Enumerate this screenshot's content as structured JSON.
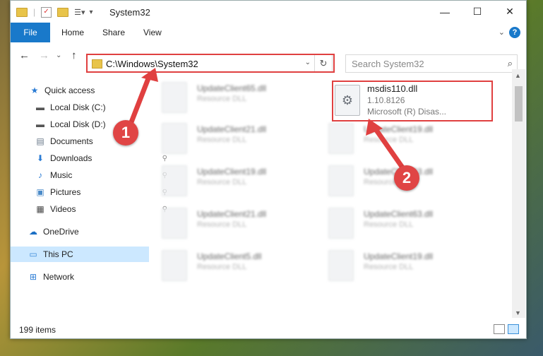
{
  "window": {
    "title": "System32",
    "controls": {
      "minimize": "—",
      "maximize": "☐",
      "close": "✕"
    }
  },
  "ribbon": {
    "tabs": [
      "File",
      "Home",
      "Share",
      "View"
    ],
    "expand": "⌄",
    "help": "?"
  },
  "nav": {
    "back": "←",
    "forward": "→",
    "recent": "⌄",
    "up": "↑",
    "address": "C:\\Windows\\System32",
    "address_dropdown": "⌄",
    "refresh": "↻",
    "search_placeholder": "Search System32",
    "search_icon": "⌕"
  },
  "sidebar": {
    "items": [
      {
        "label": "Quick access",
        "icon": "star-icon",
        "glyph": "★",
        "color": "#2a7bd4"
      },
      {
        "label": "Local Disk (C:)",
        "icon": "drive-icon",
        "glyph": "▬",
        "color": "#555555"
      },
      {
        "label": "Local Disk (D:)",
        "icon": "drive-icon",
        "glyph": "▬",
        "color": "#555555"
      },
      {
        "label": "Documents",
        "icon": "documents-icon",
        "glyph": "▤",
        "color": "#6a7a8a"
      },
      {
        "label": "Downloads",
        "icon": "download-icon",
        "glyph": "⬇",
        "color": "#2a7bd4"
      },
      {
        "label": "Music",
        "icon": "music-icon",
        "glyph": "♪",
        "color": "#2a7bd4"
      },
      {
        "label": "Pictures",
        "icon": "pictures-icon",
        "glyph": "▣",
        "color": "#4a8ac8"
      },
      {
        "label": "Videos",
        "icon": "videos-icon",
        "glyph": "▦",
        "color": "#444444"
      },
      {
        "label": "OneDrive",
        "icon": "cloud-icon",
        "glyph": "☁",
        "color": "#1a6fc4"
      },
      {
        "label": "This PC",
        "icon": "computer-icon",
        "glyph": "▭",
        "color": "#3a8ad8"
      },
      {
        "label": "Network",
        "icon": "network-icon",
        "glyph": "⊞",
        "color": "#2a7bd4"
      }
    ],
    "pin_glyph": "⚲"
  },
  "files_blurred": [
    {
      "name": "UpdateClient65.dll",
      "type": "Resource DLL"
    },
    {
      "name": "UpdateClient21.dll",
      "type": "Resource DLL"
    },
    {
      "name": "UpdateClient19.dll",
      "type": "Resource DLL"
    },
    {
      "name": "UpdateClient21.dll",
      "type": "Resource DLL"
    },
    {
      "name": "UpdateClient5.dll",
      "type": "Resource DLL"
    },
    {
      "name": "UpdateClient19.dll",
      "type": "Resource DLL"
    },
    {
      "name": "UpdateClient63.dll",
      "type": "Resource DLL"
    },
    {
      "name": "UpdateClient63.dll",
      "type": "Resource DLL"
    },
    {
      "name": "UpdateClient19.dll",
      "type": "Resource DLL"
    }
  ],
  "highlighted_file": {
    "name": "msdis110.dll",
    "version": "1.10.8126",
    "description": "Microsoft (R) Disas...",
    "icon_glyph": "⚙"
  },
  "status": {
    "items": "199 items"
  },
  "annotations": {
    "step1": "1",
    "step2": "2",
    "color": "#e04040"
  }
}
